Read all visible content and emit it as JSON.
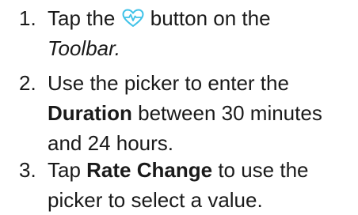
{
  "steps": [
    {
      "number": "1.",
      "pre_icon": "Tap the",
      "icon": "heart-pulse-icon",
      "post_icon": "button on the",
      "line2_italic": "Toolbar."
    },
    {
      "number": "2.",
      "line1": "Use the picker to enter the",
      "line2_bold": "Duration",
      "line2_rest": "between 30 minutes",
      "line3": "and 24 hours."
    },
    {
      "number": "3.",
      "pre_bold": "Tap",
      "bold": "Rate Change",
      "post_bold": "to use the",
      "line2": "picker to select a value."
    }
  ],
  "colors": {
    "text": "#1a1a1a",
    "icon": "#3fc2e8"
  }
}
